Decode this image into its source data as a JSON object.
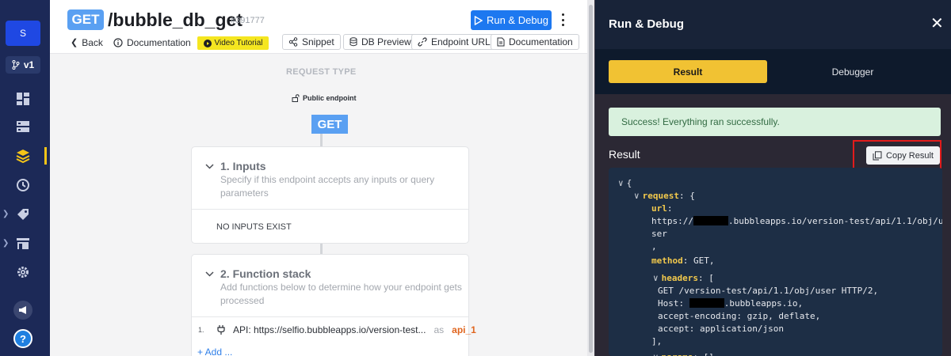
{
  "sidebar": {
    "avatar_initial": "S",
    "branch_label": "v1",
    "help_label": "?"
  },
  "header": {
    "verb": "GET",
    "endpoint_path": "/bubble_db_get",
    "endpoint_id": "#391777",
    "run_button_label": "Run & Debug",
    "back_label": "Back",
    "documentation_label": "Documentation",
    "video_tutorial_label": "Video Tutorial",
    "pills": [
      "Snippet",
      "DB Preview",
      "Endpoint URL",
      "Documentation"
    ]
  },
  "canvas": {
    "request_type_label": "REQUEST TYPE",
    "public_endpoint_label": "Public endpoint",
    "verb": "GET",
    "inputs_card": {
      "title": "1. Inputs",
      "description_line1": "Specify if this endpoint accepts any inputs or query",
      "description_line2": "parameters",
      "empty_label": "NO INPUTS EXIST"
    },
    "function_card": {
      "title": "2. Function stack",
      "description_line1": "Add functions below to determine how your endpoint gets",
      "description_line2": "processed",
      "step_number": "1.",
      "step_text": "API: https://selfio.bubbleapps.io/version-test...",
      "step_as": "as",
      "step_var": "api_1"
    },
    "add_label": "+ Add ..."
  },
  "panel": {
    "title": "Run & Debug",
    "tab_result": "Result",
    "tab_debugger": "Debugger",
    "success_message": "Success! Everything ran successfully.",
    "result_label": "Result",
    "copy_result_label": "Copy Result",
    "code": {
      "open_brace": "{",
      "request_key": "request",
      "request_open": ": {",
      "url_key": "url",
      "url_colon": ":",
      "url_prefix": "https://",
      "url_suffix": ".bubbleapps.io/version-test/api/1.1/obj/u",
      "url_wrap": "ser",
      "comma": ",",
      "method_key": "method",
      "method_value": ": GET,",
      "headers_key": "headers",
      "headers_open": ": [",
      "header_line1": "GET /version-test/api/1.1/obj/user HTTP/2,",
      "header_host_prefix": "Host: ",
      "header_host_suffix": ".bubbleapps.io,",
      "header_line3": "accept-encoding: gzip, deflate,",
      "header_line4": "accept: application/json",
      "headers_close": "],",
      "params_key": "params",
      "params_value": ": []"
    }
  }
}
